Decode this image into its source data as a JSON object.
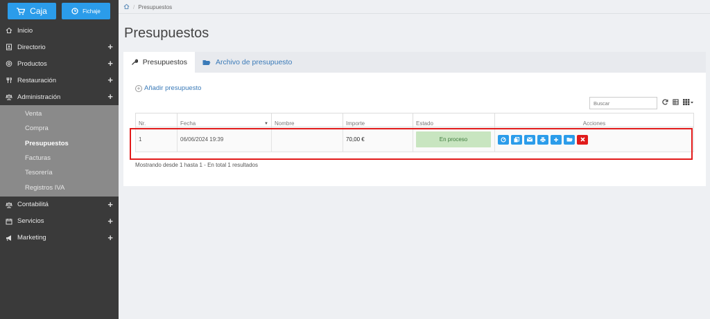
{
  "sidebar": {
    "caja_label": "Caja",
    "fichaje_label": "Fichaje",
    "items": [
      {
        "label": "Inicio",
        "icon": "home-icon"
      },
      {
        "label": "Directorio",
        "icon": "address-book-icon"
      },
      {
        "label": "Productos",
        "icon": "box-icon"
      },
      {
        "label": "Restauración",
        "icon": "cutlery-icon"
      },
      {
        "label": "Administración",
        "icon": "scale-icon"
      }
    ],
    "sub_items": [
      "Venta",
      "Compra",
      "Presupuestos",
      "Facturas",
      "Tesorería",
      "Registros IVA"
    ],
    "items_after": [
      {
        "label": "Contabilitá",
        "icon": "scale-icon"
      },
      {
        "label": "Servicios",
        "icon": "calendar-icon"
      },
      {
        "label": "Marketing",
        "icon": "megaphone-icon"
      }
    ]
  },
  "breadcrumb": {
    "current": "Presupuestos"
  },
  "page": {
    "title": "Presupuestos"
  },
  "tabs": {
    "presupuestos": "Presupuestos",
    "archivo": "Archivo de presupuesto"
  },
  "add_label": "Añadir presupuesto",
  "search": {
    "placeholder": "Buscar"
  },
  "table": {
    "headers": [
      "Nr.",
      "Fecha",
      "Nombre",
      "Importe",
      "Estado",
      "Acciones"
    ],
    "row": {
      "nr": "1",
      "fecha": "06/06/2024 19:39",
      "nombre": "",
      "importe": "70,00 €",
      "estado": "En proceso"
    }
  },
  "summary": "Mostrando desde 1 hasta 1 - En total 1 resultados",
  "colors": {
    "accent": "#2b9cea",
    "sidebar": "#3a3a3a",
    "highlight": "#e21a1a",
    "status_bg": "#c8e5c0"
  }
}
